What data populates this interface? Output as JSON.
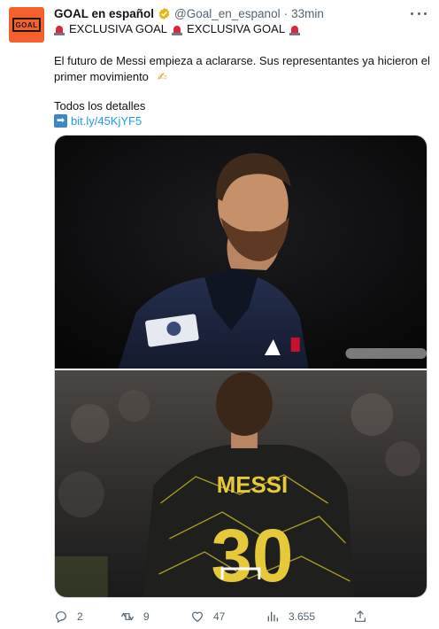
{
  "account": {
    "name": "GOAL en español",
    "handle": "@Goal_en_espanol",
    "separator": "·",
    "time": "33min",
    "avatar_text": "GOAL"
  },
  "tweet": {
    "exclusive_1": "EXCLUSIVA GOAL",
    "exclusive_2": "EXCLUSIVA GOAL",
    "text": "El futuro de Messi empieza a aclararse. Sus representantes ya hicieron el primer movimiento",
    "details": "Todos los detalles",
    "link_arrow": "➡",
    "link": "bit.ly/45KjYF5"
  },
  "media": {
    "jersey_name": "MESSI",
    "jersey_number": "30"
  },
  "actions": {
    "replies": "2",
    "retweets": "9",
    "likes": "47",
    "views": "3.655"
  },
  "icons": {
    "verified": "verified-badge-icon",
    "more": "more-icon",
    "siren": "police-light-icon",
    "pen": "writing-hand-icon",
    "reply": "reply-icon",
    "retweet": "retweet-icon",
    "like": "heart-icon",
    "views": "analytics-icon",
    "share": "share-icon"
  },
  "colors": {
    "brand": "#f4612f",
    "link": "#1d9bf0",
    "muted": "#536471",
    "verified_gold": "#e2b719"
  }
}
